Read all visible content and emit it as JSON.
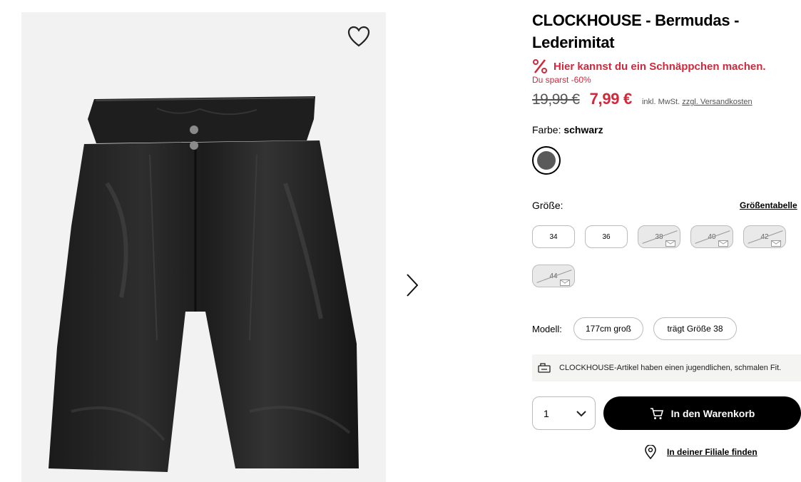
{
  "product": {
    "title": "CLOCKHOUSE - Bermudas - Lederimitat",
    "image_icon": "leather-bermuda-shorts-black"
  },
  "deal": {
    "icon": "percent-icon",
    "text": "Hier kannst du ein Schnäppchen machen.",
    "saving": "Du sparst -60%"
  },
  "price": {
    "old": "19,99 €",
    "new": "7,99 €",
    "tax_prefix": "inkl. MwSt.",
    "shipping_link": "zzgl. Versandkosten",
    "accent_color": "#d2283c"
  },
  "color": {
    "label": "Farbe:",
    "value": "schwarz",
    "swatch_hex": "#5a5a5a"
  },
  "size": {
    "label": "Größe:",
    "table_link": "Größentabelle",
    "options": [
      {
        "label": "34",
        "available": true
      },
      {
        "label": "36",
        "available": true
      },
      {
        "label": "38",
        "available": false
      },
      {
        "label": "40",
        "available": false
      },
      {
        "label": "42",
        "available": false
      },
      {
        "label": "44",
        "available": false
      }
    ]
  },
  "model": {
    "label": "Modell:",
    "height": "177cm groß",
    "size": "trägt Größe 38"
  },
  "info": {
    "icon": "hanger-icon",
    "text": "CLOCKHOUSE-Artikel haben einen jugendlichen, schmalen Fit."
  },
  "purchase": {
    "quantity": "1",
    "cart_label": "In den Warenkorb",
    "store_label": "In deiner Filiale finden"
  }
}
